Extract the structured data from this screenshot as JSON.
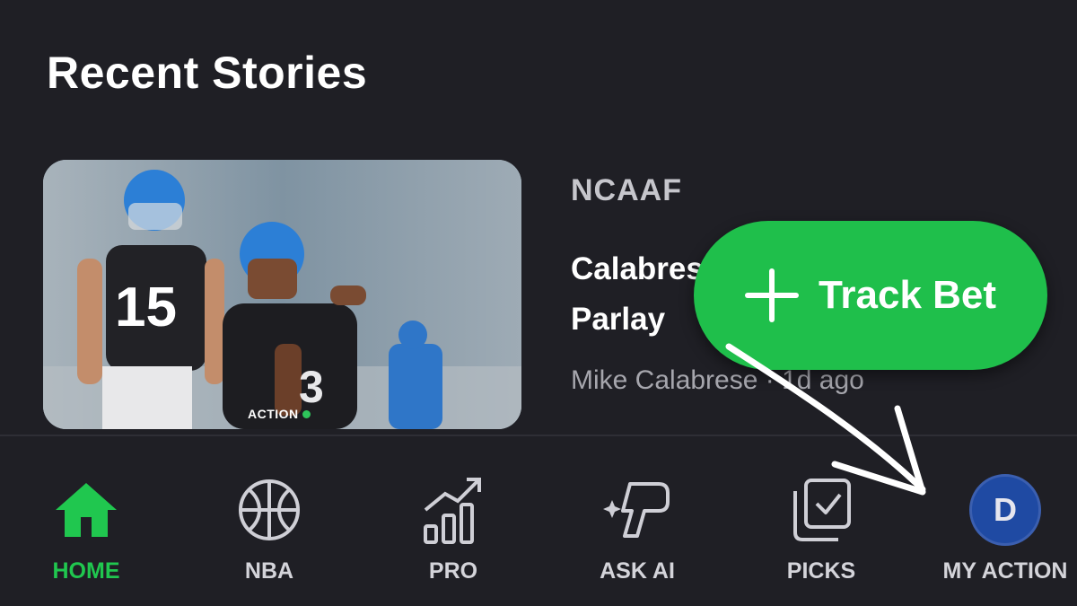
{
  "section": {
    "title": "Recent Stories"
  },
  "story": {
    "league": "NCAAF",
    "headline": "Calabrese's Parlay",
    "byline": "Mike Calabrese · 1d ago",
    "image_watermark": "ACTION",
    "jersey_number_front": "15",
    "jersey_number_back": "3"
  },
  "fab": {
    "label": "Track Bet",
    "icon": "plus-icon"
  },
  "tabbar": {
    "items": [
      {
        "label": "HOME",
        "icon": "home-icon",
        "active": true
      },
      {
        "label": "NBA",
        "icon": "basketball-icon",
        "active": false
      },
      {
        "label": "PRO",
        "icon": "bar-chart-trend-icon",
        "active": false
      },
      {
        "label": "ASK AI",
        "icon": "ai-sparkle-icon",
        "active": false
      },
      {
        "label": "PICKS",
        "icon": "picks-check-icon",
        "active": false
      },
      {
        "label": "MY ACTION",
        "icon": "avatar",
        "active": false,
        "avatar_initial": "D"
      }
    ]
  },
  "colors": {
    "background": "#1f1f25",
    "accent": "#1fbf4b",
    "active_tab": "#20c74f",
    "avatar": "#1f4aa3"
  }
}
